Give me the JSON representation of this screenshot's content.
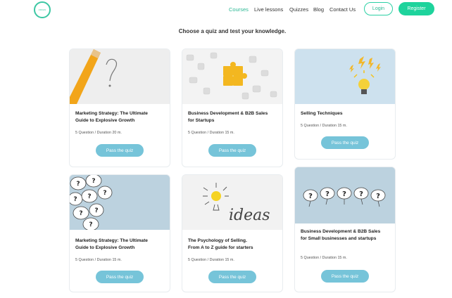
{
  "header": {
    "logo_text": "ORIGIN",
    "nav": [
      "Courses",
      "Live lessons",
      "Quizzes",
      "Blog",
      "Contact Us"
    ],
    "login_label": "Login",
    "register_label": "Register"
  },
  "heading": "Choose a quiz and test your knowledge.",
  "cards": [
    {
      "title_1": "Marketing Strategy: The Ultimate",
      "title_2": "Guide to Explosive Growth",
      "meta": "5 Question / Duration 20 m.",
      "button": "Pass the quiz"
    },
    {
      "title_1": "Business Development & B2B Sales",
      "title_2": "for Startups",
      "meta": "5 Question / Duration 15 m.",
      "button": "Pass the quiz"
    },
    {
      "title_1": "Selling Techniques",
      "title_2": "",
      "meta": "5 Question / Duration 15 m.",
      "button": "Pass the quiz"
    },
    {
      "title_1": "Marketing Strategy: The Ultimate",
      "title_2": "Guide to Explosive Growth",
      "meta": "5 Question / Duration 15 m.",
      "button": "Pass the quiz"
    },
    {
      "title_1": "The Psychology of Selling.",
      "title_2": "From A to Z guide for starters",
      "meta": "5 Question / Duration 15 m.",
      "button": "Pass the quiz"
    },
    {
      "title_1": "Business Development & B2B Sales",
      "title_2": "for Small businesses and startups",
      "meta": "5 Question / Duration 15 m.",
      "button": "Pass the quiz"
    }
  ],
  "images": {
    "ideas_word": "ideas",
    "question_mark": "?"
  },
  "colors": {
    "accent": "#1ed39c",
    "active_nav": "#2bb894",
    "quiz_button": "#76c4d9"
  }
}
